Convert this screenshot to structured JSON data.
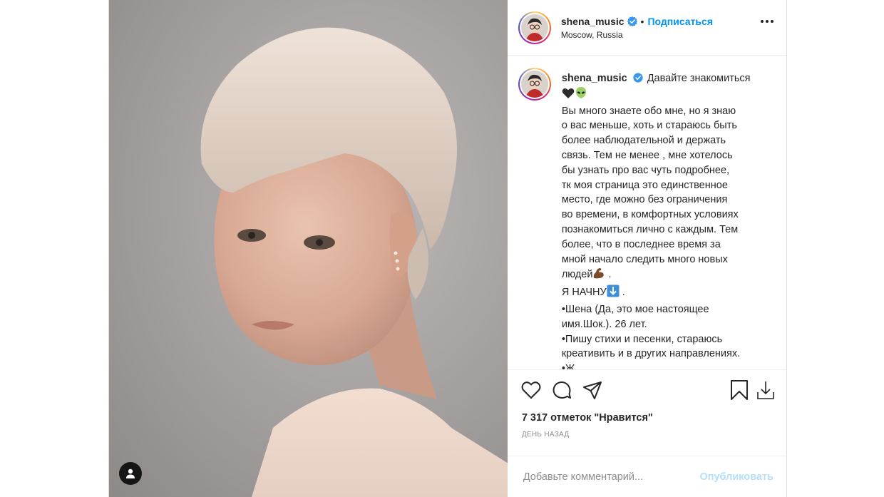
{
  "post": {
    "username": "shena_music",
    "follow_label": "Подписаться",
    "separator": "•",
    "location": "Moscow, Russia"
  },
  "caption": {
    "username": "shena_music",
    "lines": [
      "Давайте знакомиться",
      "Вы много знаете обо мне, но я знаю",
      "о вас меньше, хоть и стараюсь быть",
      "более наблюдательной и держать",
      "связь. Тем не менее , мне хотелось",
      "бы узнать про вас чуть подробнее,",
      "тк моя страница это единственное",
      "место, где можно без ограничения",
      "во времени, в комфортных условиях",
      "познакомиться лично с каждым. Тем",
      "более, что в последнее время за",
      "мной начало следить много новых",
      "людей",
      " .",
      "Я НАЧНУ",
      " .",
      "•Шена (Да, это мое настоящее",
      "имя.Шок.). 26 лет.",
      "•Пишу стихи и песенки, стараюсь",
      "креативить и в других направлениях.",
      "•Ж"
    ]
  },
  "icons": {
    "like": "heart-outline-icon",
    "comment": "comment-bubble-icon",
    "share": "paper-plane-icon",
    "save": "bookmark-icon",
    "download": "download-icon",
    "user_tag": "user-tag-icon",
    "more": "more-options-icon",
    "verified": "verified-badge-icon"
  },
  "likes_text": "7 317 отметок \"Нравится\"",
  "time_text": "день назад",
  "comment": {
    "placeholder": "Добавьте комментарий...",
    "publish_label": "Опубликовать"
  },
  "colors": {
    "accent": "#0095f6",
    "publish_disabled": "#b2dffc",
    "muted": "#8e8e8e"
  }
}
